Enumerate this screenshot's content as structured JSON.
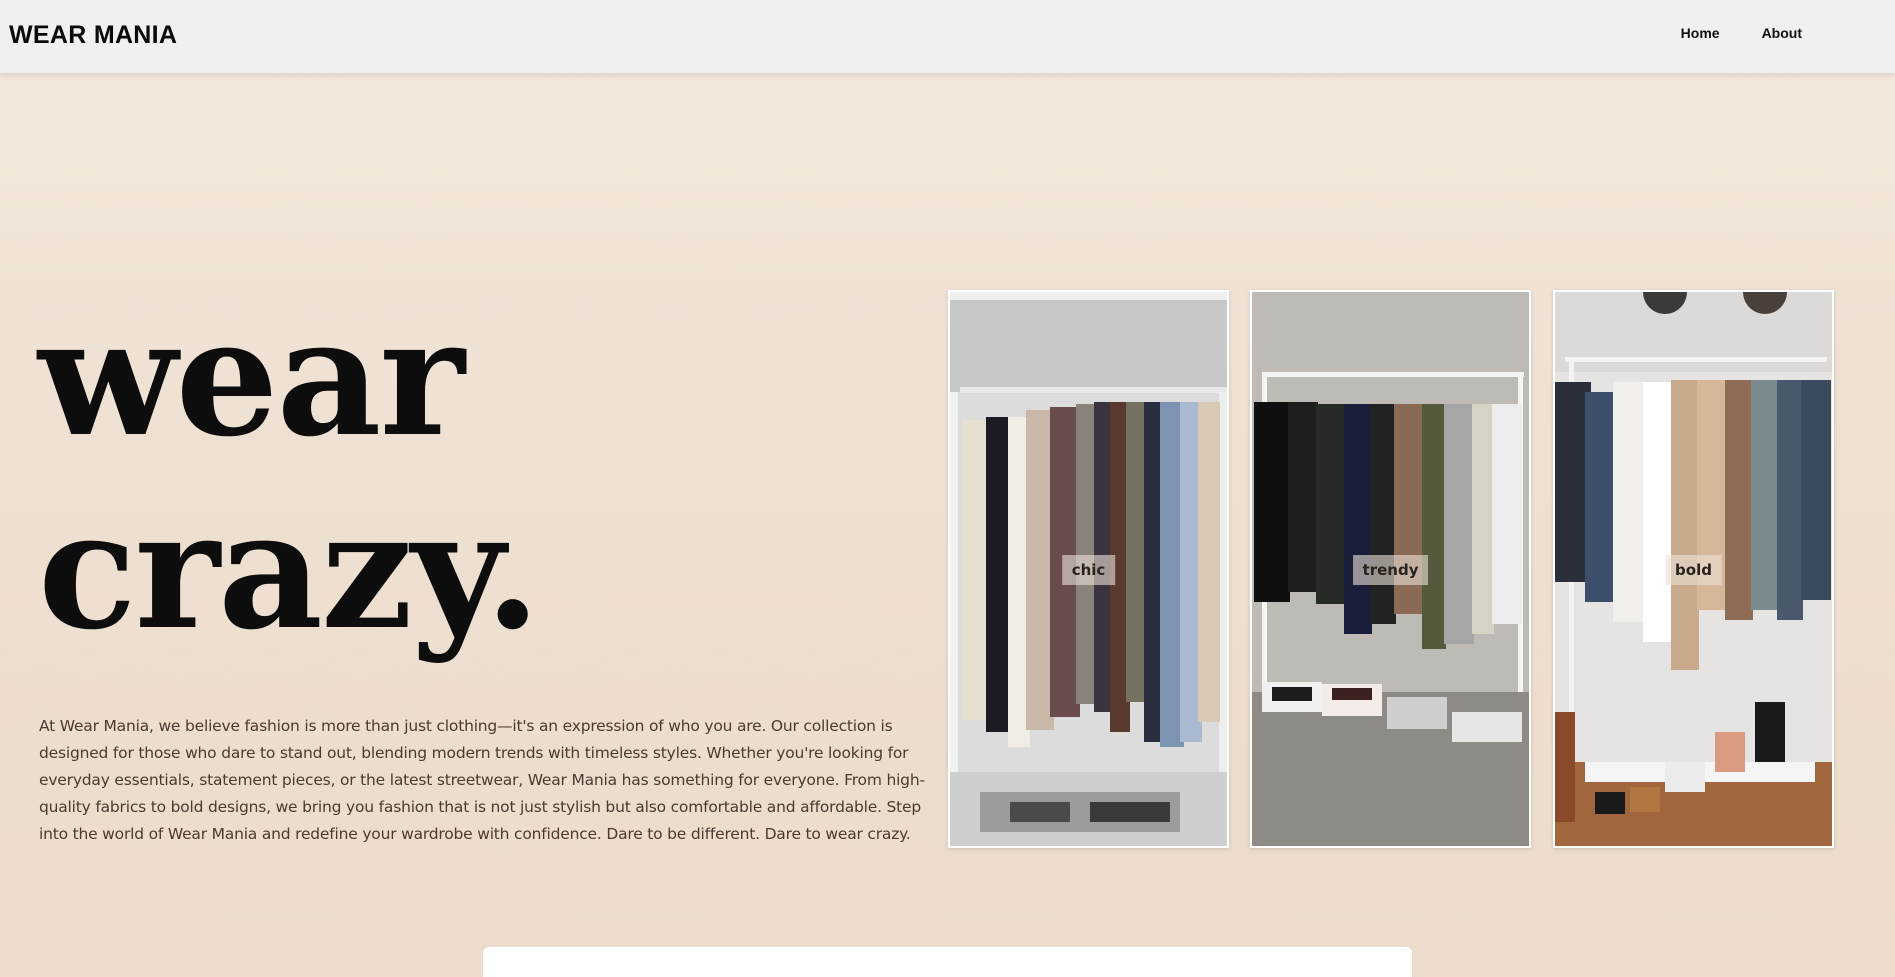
{
  "nav": {
    "brand": "WEAR MANIA",
    "links": [
      {
        "label": "Home"
      },
      {
        "label": "About"
      }
    ]
  },
  "hero": {
    "line1": "wear",
    "line2": "crazy.",
    "description": "At Wear Mania, we believe fashion is more than just clothing—it's an expression of who you are. Our collection is designed for those who dare to stand out, blending modern trends with timeless styles. Whether you're looking for everyday essentials, statement pieces, or the latest streetwear, Wear Mania has something for everyone. From high-quality fabrics to bold designs, we bring you fashion that is not just stylish but also comfortable and affordable. Step into the world of Wear Mania and redefine your wardrobe with confidence. Dare to be different. Dare to wear crazy."
  },
  "gallery": {
    "cards": [
      {
        "label": "chic",
        "image": "closet-jackets-photo"
      },
      {
        "label": "trendy",
        "image": "clothing-rack-sneakers-photo"
      },
      {
        "label": "bold",
        "image": "neutral-wardrobe-rack-photo"
      }
    ]
  },
  "colors": {
    "nav_bg": "#f2f0ec",
    "page_bg": "#f0e4d7",
    "heading": "#0d0d0d",
    "body_text": "#4b3a32",
    "card_border": "#ffffff"
  }
}
